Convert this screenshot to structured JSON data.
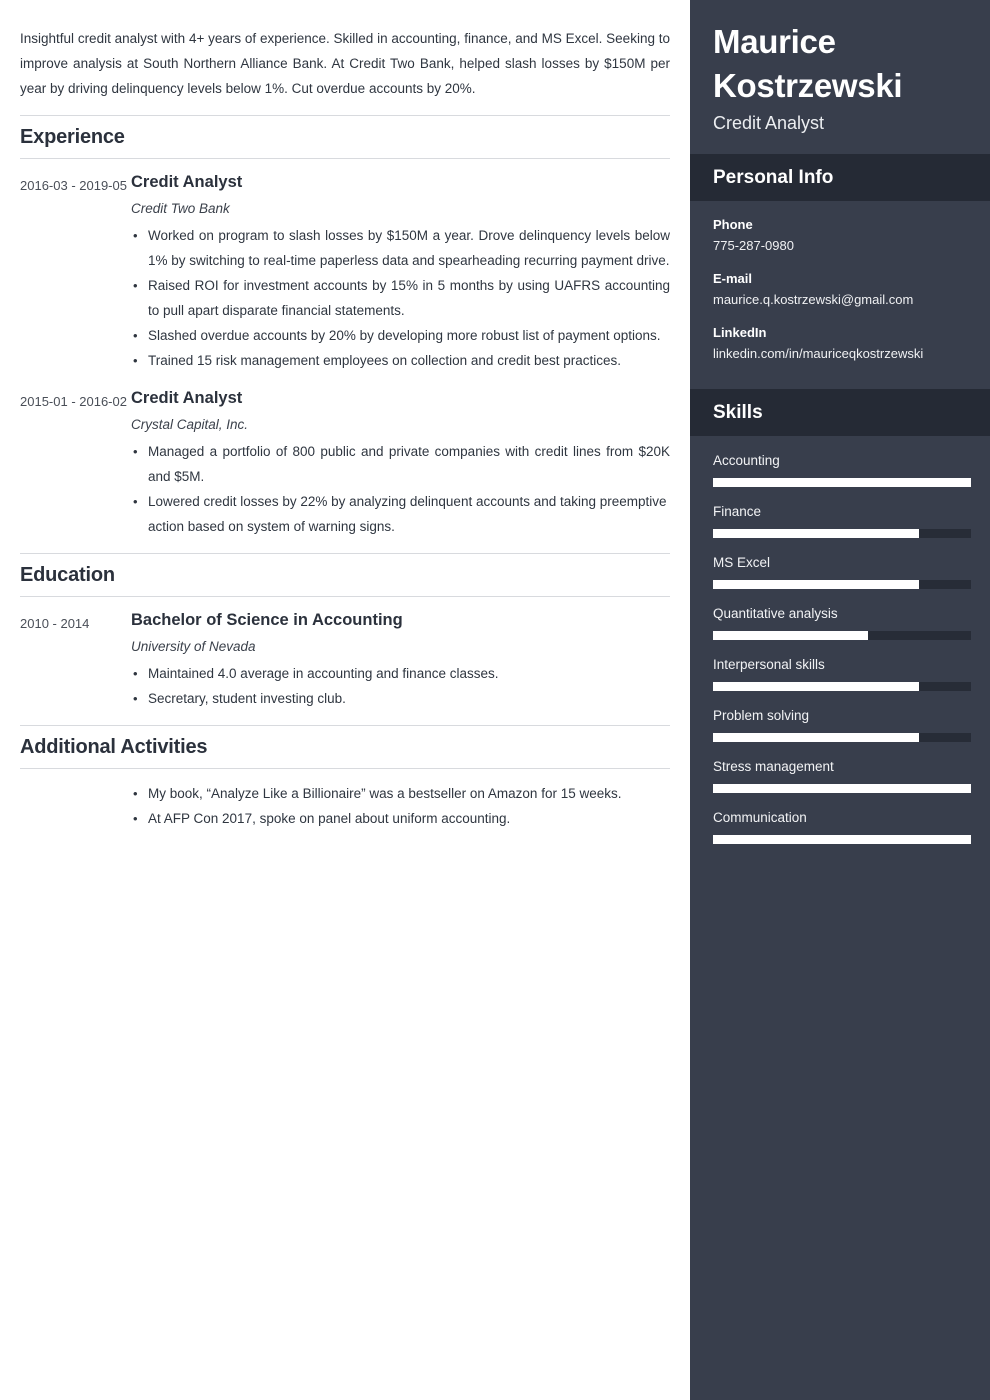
{
  "summary": "Insightful credit analyst with 4+ years of experience. Skilled in accounting, finance, and MS Excel. Seeking to improve analysis at South Northern Alliance Bank. At Credit Two Bank, helped slash losses by $150M per year by driving delinquency levels below 1%. Cut overdue accounts by 20%.",
  "sections": {
    "experience": {
      "heading": "Experience",
      "entries": [
        {
          "dates": "2016-03 - 2019-05",
          "title": "Credit Analyst",
          "org": "Credit Two Bank",
          "bullets": [
            "Worked on program to slash losses by $150M a year. Drove delinquency levels below 1% by switching to real-time paperless data and spearheading recurring payment drive.",
            "Raised ROI for investment accounts by 15% in 5 months by using UAFRS accounting to pull apart disparate financial statements.",
            "Slashed overdue accounts by 20% by developing more robust list of payment options.",
            "Trained 15 risk management employees on collection and credit best practices."
          ]
        },
        {
          "dates": "2015-01 - 2016-02",
          "title": "Credit Analyst",
          "org": "Crystal Capital, Inc.",
          "bullets": [
            "Managed a portfolio of 800 public and private companies with credit lines from $20K and $5M.",
            "Lowered credit losses by 22% by analyzing delinquent accounts and taking preemptive action based on system of warning signs."
          ]
        }
      ]
    },
    "education": {
      "heading": "Education",
      "entries": [
        {
          "dates": "2010 - 2014",
          "title": "Bachelor of Science in Accounting",
          "org": "University of Nevada",
          "bullets": [
            "Maintained 4.0 average in accounting and finance classes.",
            "Secretary, student investing club."
          ]
        }
      ]
    },
    "additional": {
      "heading": "Additional Activities",
      "entries": [
        {
          "dates": "",
          "title": "",
          "org": "",
          "bullets": [
            "My book, “Analyze Like a Billionaire” was a bestseller on Amazon for 15 weeks.",
            "At AFP Con 2017, spoke on panel about uniform accounting."
          ]
        }
      ]
    }
  },
  "sidebar": {
    "name": "Maurice Kostrzewski",
    "role": "Credit Analyst",
    "personal_info": {
      "heading": "Personal Info",
      "items": [
        {
          "label": "Phone",
          "value": "775-287-0980"
        },
        {
          "label": "E-mail",
          "value": "maurice.q.kostrzewski@gmail.com"
        },
        {
          "label": "LinkedIn",
          "value": "linkedin.com/in/mauriceqkostrzewski"
        }
      ]
    },
    "skills": {
      "heading": "Skills",
      "items": [
        {
          "name": "Accounting",
          "level": 100
        },
        {
          "name": "Finance",
          "level": 80
        },
        {
          "name": "MS Excel",
          "level": 80
        },
        {
          "name": "Quantitative analysis",
          "level": 60
        },
        {
          "name": "Interpersonal skills",
          "level": 80
        },
        {
          "name": "Problem solving",
          "level": 80
        },
        {
          "name": "Stress management",
          "level": 100
        },
        {
          "name": "Communication",
          "level": 100
        }
      ]
    }
  },
  "colors": {
    "sidebar_bg": "#383e4c",
    "sidebar_band_bg": "#252a35",
    "skill_track": "#272c37",
    "skill_fill": "#ffffff",
    "text_dark": "#2f3640",
    "rule": "#d8dade"
  }
}
